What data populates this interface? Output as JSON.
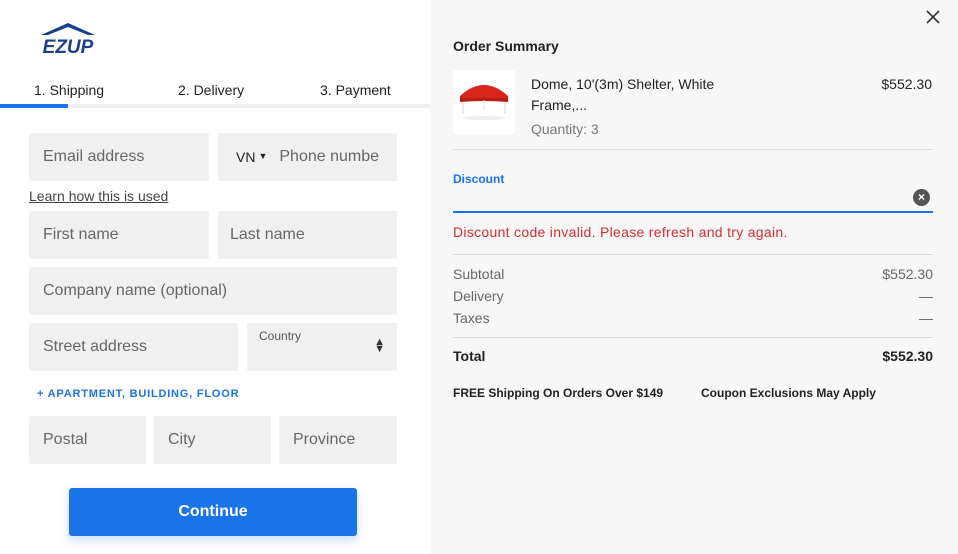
{
  "brand": {
    "logo_text": "EZUP"
  },
  "steps": [
    {
      "label": "1. Shipping"
    },
    {
      "label": "2. Delivery"
    },
    {
      "label": "3. Payment"
    }
  ],
  "form": {
    "email_placeholder": "Email address",
    "phone_country_code": "VN",
    "phone_placeholder": "Phone numbe",
    "learn_link": "Learn how this is used",
    "first_name_placeholder": "First name",
    "last_name_placeholder": "Last name",
    "company_placeholder": "Company name (optional)",
    "street_placeholder": "Street address",
    "country_label": "Country",
    "apartment_link": "+ APARTMENT, BUILDING, FLOOR",
    "postal_placeholder": "Postal",
    "city_placeholder": "City",
    "province_placeholder": "Province",
    "continue_label": "Continue"
  },
  "summary": {
    "title": "Order Summary",
    "item": {
      "name": "Dome, 10'(3m) Shelter, White Frame,...",
      "quantity": "Quantity: 3",
      "price": "$552.30"
    },
    "discount_label": "Discount",
    "discount_error": "Discount code invalid. Please refresh and try again.",
    "subtotal_label": "Subtotal",
    "subtotal_value": "$552.30",
    "delivery_label": "Delivery",
    "delivery_value": "—",
    "taxes_label": "Taxes",
    "taxes_value": "—",
    "total_label": "Total",
    "total_value": "$552.30",
    "note_shipping": "FREE Shipping On Orders Over $149",
    "note_coupon": "Coupon Exclusions May Apply"
  },
  "colors": {
    "accent": "#1a73e8",
    "error": "#d62e2e",
    "logo_blue": "#1b3f8b",
    "tent_red": "#d9261c"
  }
}
